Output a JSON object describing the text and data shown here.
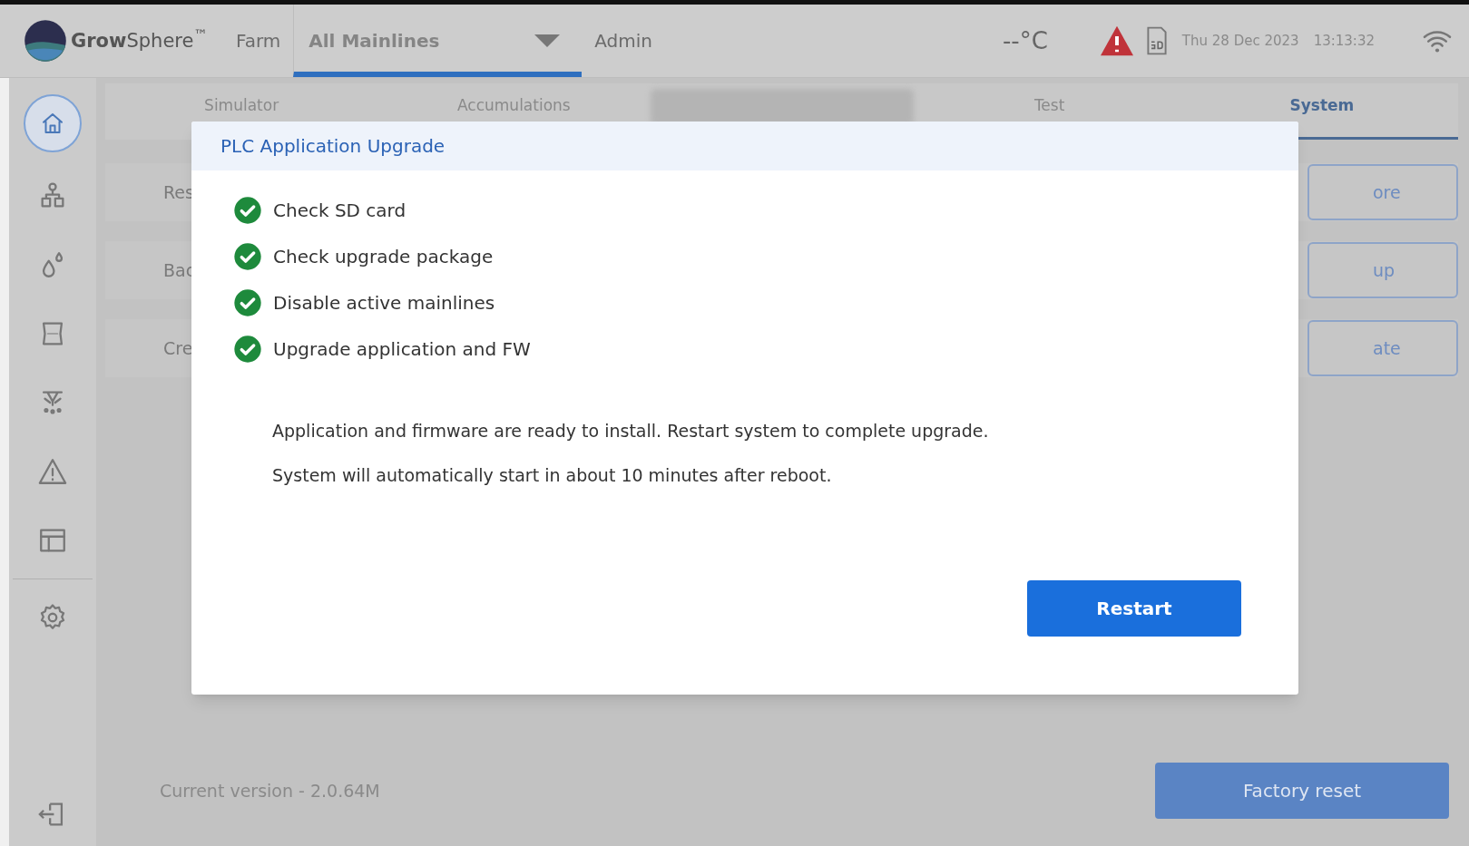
{
  "header": {
    "brand": "**Grow**Sphere$^{™}$",
    "nav": [
      {
        "label": "Farm",
        "kind": "link",
        "selected": false
      },
      {
        "label": "All Mainlines",
        "kind": "dropdown",
        "selected": true
      },
      {
        "label": "Admin",
        "kind": "link",
        "selected": false
      }
    ],
    "temperature": "--°C",
    "alert": true,
    "date": "Thu 28 Dec 2023",
    "time": "13:13:32"
  },
  "sidebar": {
    "items": [
      {
        "kind": "home",
        "selected": true
      },
      {
        "kind": "sites",
        "selected": false
      },
      {
        "kind": "water",
        "selected": false
      },
      {
        "kind": "fertilizer",
        "selected": false
      },
      {
        "kind": "sprinkler",
        "selected": false
      },
      {
        "kind": "alarm",
        "selected": false
      },
      {
        "kind": "table",
        "selected": false
      },
      {
        "kind": "settings",
        "selected": false
      }
    ]
  },
  "tabs": [
    {
      "label": "Simulator",
      "selected": false
    },
    {
      "label": "Accumulations",
      "selected": false
    },
    {
      "label": "Test",
      "selected": false
    },
    {
      "label": "System",
      "selected": true
    }
  ],
  "rows": [
    {
      "label": "Res",
      "button": "ore"
    },
    {
      "label": "Bac",
      "button": "up"
    },
    {
      "label": "Cre",
      "button": "ate"
    }
  ],
  "footer": {
    "version": "Current version - 2.0.64M",
    "button": "Factory reset"
  },
  "dialog": {
    "title": "PLC Application Upgrade",
    "steps": [
      {
        "label": "Check SD card",
        "done": true
      },
      {
        "label": "Check upgrade package",
        "done": true
      },
      {
        "label": "Disable active mainlines",
        "done": true
      },
      {
        "label": "Upgrade application and FW",
        "done": true
      }
    ],
    "messages": [
      "Application and firmware are ready to install. Restart system to complete upgrade.",
      "System will automatically start in about 10 minutes after reboot."
    ],
    "button": "Restart"
  }
}
